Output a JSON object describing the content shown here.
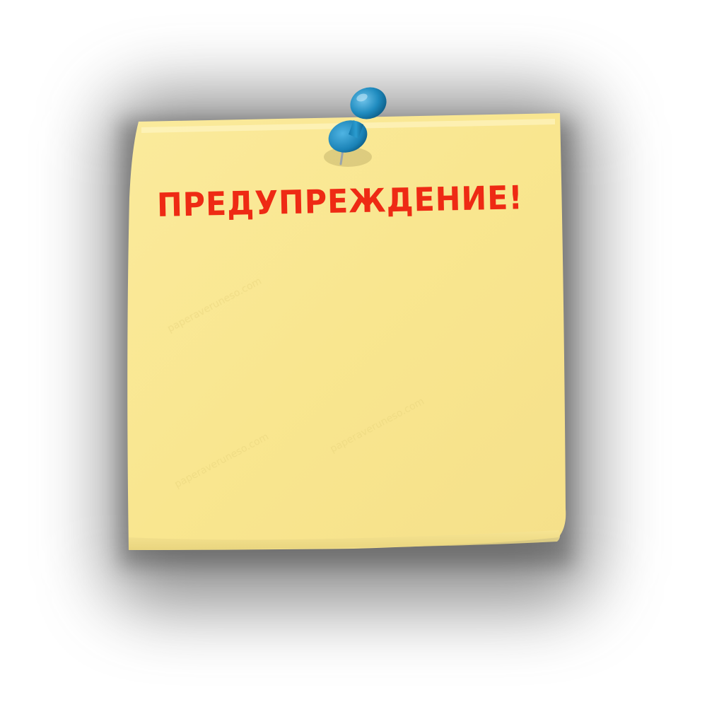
{
  "note": {
    "title": "ПРЕДУПРЕЖДЕНИЕ!",
    "paper_color": "#f8e48e",
    "text_color": "#ee2a14"
  },
  "pin": {
    "icon": "pushpin-icon",
    "color": "#1f8bbf"
  },
  "watermark": {
    "text": "paperaveruneso.com"
  }
}
